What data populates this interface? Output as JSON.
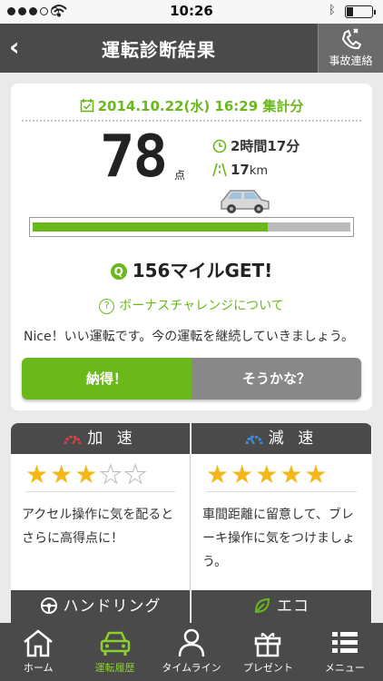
{
  "status_bar": {
    "time": "10:26",
    "battery_level": 0.25
  },
  "nav": {
    "title": "運転診断結果",
    "accident_label": "事故連絡"
  },
  "result": {
    "date": "2014.10.22(水) 16:29 集計分",
    "score": "78",
    "score_unit": "点",
    "duration": "2時間17分",
    "distance": "17",
    "distance_unit": "km",
    "progress": 0.74,
    "miles": "156マイルGET!",
    "bonus_link": "ボーナスチャレンジについて",
    "message": "Nice！いい運転です。今の運転を継続していきましょう。",
    "agree_button": "納得！",
    "disagree_button": "そうかな？"
  },
  "evaluation": {
    "acceleration": {
      "label": "加 速",
      "stars": 3,
      "max_stars": 5,
      "advice": "アクセル操作に気を配るとさらに高得点に！",
      "icon_color": "#e04040"
    },
    "deceleration": {
      "label": "減 速",
      "stars": 5,
      "max_stars": 5,
      "advice": "車間距離に留意して、ブレーキ操作に気をつけましょう。",
      "icon_color": "#3a8ee0"
    },
    "handling_label": "ハンドリング",
    "eco_label": "エコ"
  },
  "tabs": [
    {
      "label": "ホーム",
      "icon": "home-icon"
    },
    {
      "label": "運転履歴",
      "icon": "car-icon",
      "active": true
    },
    {
      "label": "タイムライン",
      "icon": "person-icon"
    },
    {
      "label": "プレゼント",
      "icon": "gift-icon"
    },
    {
      "label": "メニュー",
      "icon": "menu-icon"
    }
  ],
  "colors": {
    "accent": "#6ab81c",
    "dark": "#4a4a4a",
    "star": "#f3b817"
  }
}
